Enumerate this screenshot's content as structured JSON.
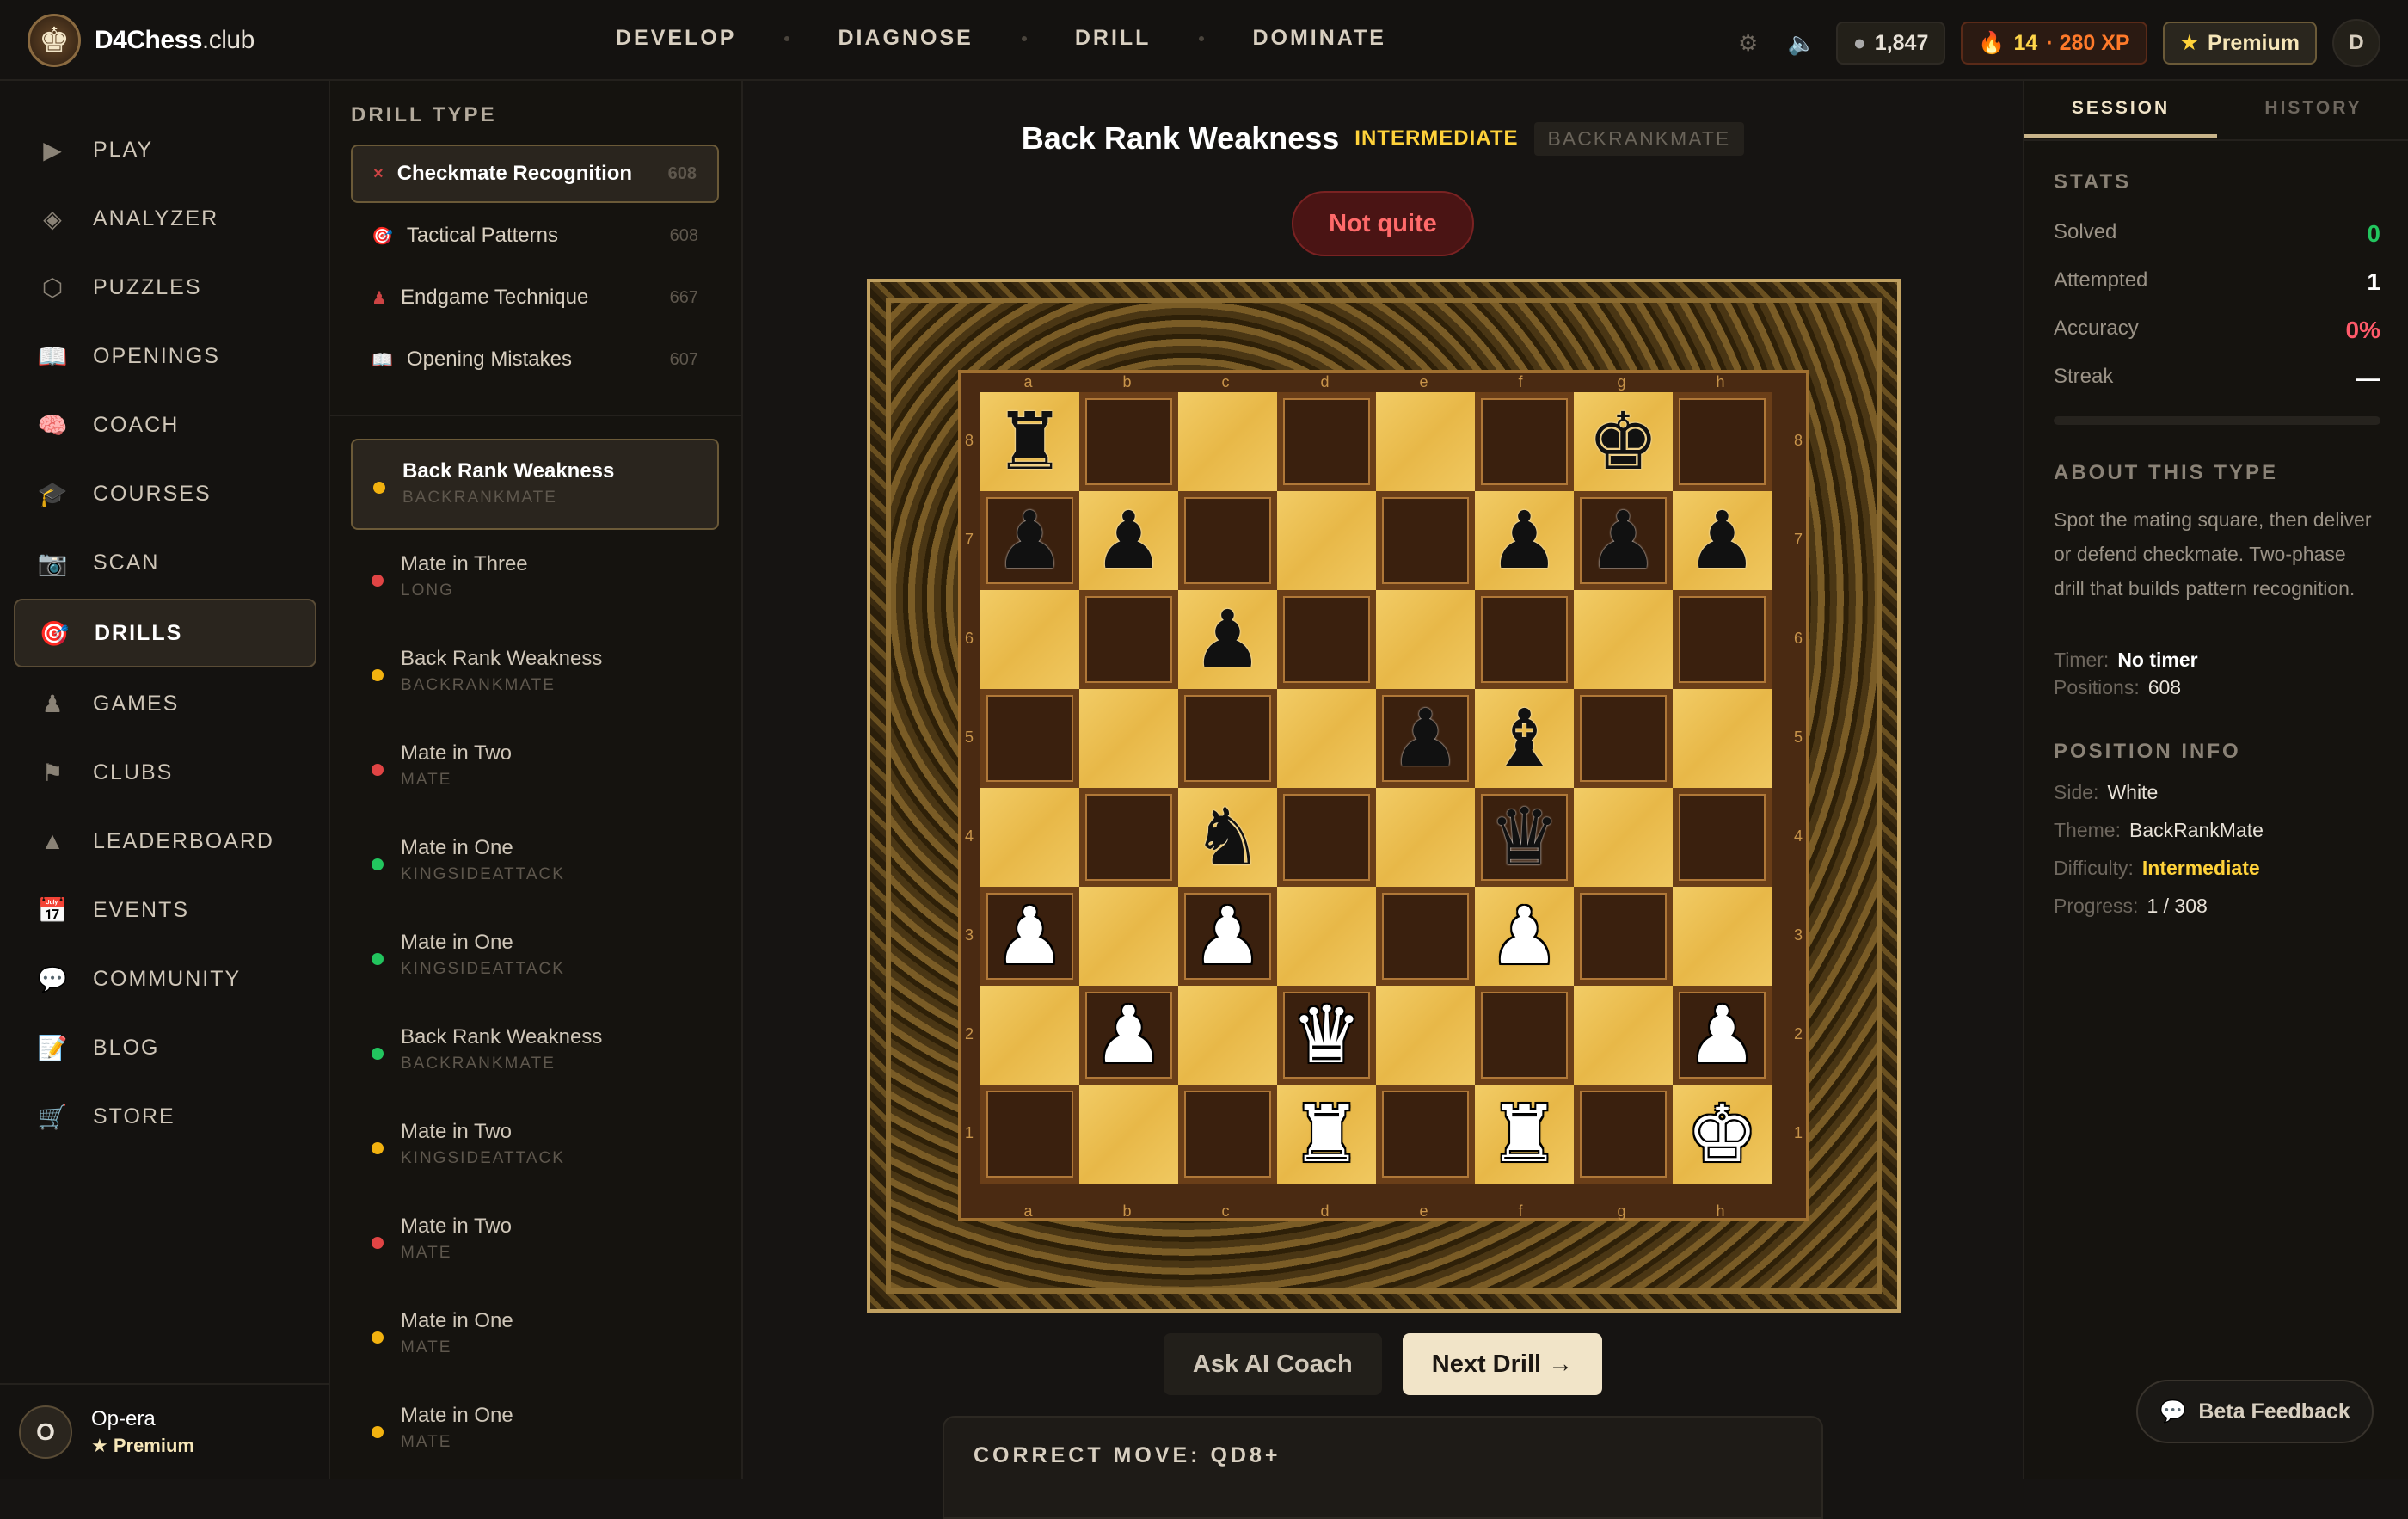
{
  "app": {
    "name": "D4Chess",
    "tld": ".club",
    "logo_glyph": "♚"
  },
  "nav": [
    "DEVELOP",
    "DIAGNOSE",
    "DRILL",
    "DOMINATE"
  ],
  "topbar": {
    "rating": "1,847",
    "streak": "14",
    "xp": "· 280 XP",
    "premium": "Premium",
    "user_initial": "D",
    "icons": {
      "settings": "⚙",
      "sound": "🔈",
      "rating_dot": "●",
      "fire": "🔥",
      "star": "★"
    }
  },
  "sidebar": {
    "items": [
      {
        "label": "PLAY",
        "icon": "▶",
        "active": false
      },
      {
        "label": "ANALYZER",
        "icon": "◈",
        "active": false
      },
      {
        "label": "PUZZLES",
        "icon": "⬡",
        "active": false
      },
      {
        "label": "OPENINGS",
        "icon": "📖",
        "active": false
      },
      {
        "label": "COACH",
        "icon": "🧠",
        "active": false
      },
      {
        "label": "COURSES",
        "icon": "🎓",
        "active": false
      },
      {
        "label": "SCAN",
        "icon": "📷",
        "active": false
      },
      {
        "label": "DRILLS",
        "icon": "🎯",
        "active": true
      },
      {
        "label": "GAMES",
        "icon": "♟",
        "active": false
      },
      {
        "label": "CLUBS",
        "icon": "⚑",
        "active": false
      },
      {
        "label": "LEADERBOARD",
        "icon": "▲",
        "active": false
      },
      {
        "label": "EVENTS",
        "icon": "📅",
        "active": false
      },
      {
        "label": "COMMUNITY",
        "icon": "💬",
        "active": false
      },
      {
        "label": "BLOG",
        "icon": "📝",
        "active": false
      },
      {
        "label": "STORE",
        "icon": "🛒",
        "active": false
      }
    ],
    "user": {
      "initial": "O",
      "name": "Op-era",
      "plan": "★ Premium"
    }
  },
  "drill_types": {
    "label": "DRILL TYPE",
    "items": [
      {
        "label": "Checkmate Recognition",
        "count": "608",
        "icon": "×",
        "active": true
      },
      {
        "label": "Tactical Patterns",
        "count": "608",
        "icon": "🎯",
        "active": false
      },
      {
        "label": "Endgame Technique",
        "count": "667",
        "icon": "♟",
        "active": false
      },
      {
        "label": "Opening Mistakes",
        "count": "607",
        "icon": "📖",
        "active": false
      }
    ]
  },
  "drills": [
    {
      "title": "Back Rank Weakness",
      "tag": "BACKRANKMATE",
      "color": "#f2b20f",
      "active": true
    },
    {
      "title": "Mate in Three",
      "tag": "LONG",
      "color": "#e04444",
      "active": false
    },
    {
      "title": "Back Rank Weakness",
      "tag": "BACKRANKMATE",
      "color": "#f2b20f",
      "active": false
    },
    {
      "title": "Mate in Two",
      "tag": "MATE",
      "color": "#e04444",
      "active": false
    },
    {
      "title": "Mate in One",
      "tag": "KINGSIDEATTACK",
      "color": "#22c55e",
      "active": false
    },
    {
      "title": "Mate in One",
      "tag": "KINGSIDEATTACK",
      "color": "#22c55e",
      "active": false
    },
    {
      "title": "Back Rank Weakness",
      "tag": "BACKRANKMATE",
      "color": "#22c55e",
      "active": false
    },
    {
      "title": "Mate in Two",
      "tag": "KINGSIDEATTACK",
      "color": "#f2b20f",
      "active": false
    },
    {
      "title": "Mate in Two",
      "tag": "MATE",
      "color": "#e04444",
      "active": false
    },
    {
      "title": "Mate in One",
      "tag": "MATE",
      "color": "#f2b20f",
      "active": false
    },
    {
      "title": "Mate in One",
      "tag": "MATE",
      "color": "#f2b20f",
      "active": false
    }
  ],
  "puzzle": {
    "title": "Back Rank Weakness",
    "difficulty": "INTERMEDIATE",
    "theme": "BACKRANKMATE",
    "status": "Not quite",
    "files": [
      "a",
      "b",
      "c",
      "d",
      "e",
      "f",
      "g",
      "h"
    ],
    "ranks": [
      "8",
      "7",
      "6",
      "5",
      "4",
      "3",
      "2",
      "1"
    ],
    "board": [
      [
        "r",
        "",
        "",
        "",
        "",
        "",
        "k",
        ""
      ],
      [
        "p",
        "p",
        "",
        "",
        "",
        "p",
        "p",
        "p"
      ],
      [
        "",
        "",
        "p",
        "",
        "",
        "",
        "",
        ""
      ],
      [
        "",
        "",
        "",
        "",
        "p",
        "b",
        "",
        ""
      ],
      [
        "",
        "",
        "n",
        "",
        "",
        "q",
        "",
        ""
      ],
      [
        "P",
        "",
        "P",
        "",
        "",
        "P",
        "",
        ""
      ],
      [
        "",
        "P",
        "",
        "Q",
        "",
        "",
        "",
        "P"
      ],
      [
        "",
        "",
        "",
        "R",
        "",
        "R",
        "",
        "K"
      ]
    ],
    "ask_coach": "Ask AI Coach",
    "next": "Next Drill →",
    "correct_move": "CORRECT MOVE: QD8+"
  },
  "right": {
    "tabs": [
      "SESSION",
      "HISTORY"
    ],
    "stats_label": "STATS",
    "stats": [
      {
        "label": "Solved",
        "value": "0",
        "color": "#22c55e"
      },
      {
        "label": "Attempted",
        "value": "1",
        "color": "#ffffff"
      },
      {
        "label": "Accuracy",
        "value": "0%",
        "color": "#ff5a6a"
      },
      {
        "label": "Streak",
        "value": "—",
        "color": "#ffffff"
      }
    ],
    "about_label": "ABOUT THIS TYPE",
    "about_text": "Spot the mating square, then deliver or defend checkmate. Two-phase drill that builds pattern recognition.",
    "timer_label": "Timer:",
    "timer_value": "No timer",
    "positions_label": "Positions:",
    "positions_value": "608",
    "position_label": "POSITION INFO",
    "side_label": "Side:",
    "side_value": "White",
    "theme_label": "Theme:",
    "theme_value": "BackRankMate",
    "difficulty_label": "Difficulty:",
    "difficulty_value": "Intermediate",
    "progress_label": "Progress:",
    "progress_value": "1 / 308"
  },
  "feedback": {
    "label": "Beta Feedback",
    "icon": "💬"
  }
}
